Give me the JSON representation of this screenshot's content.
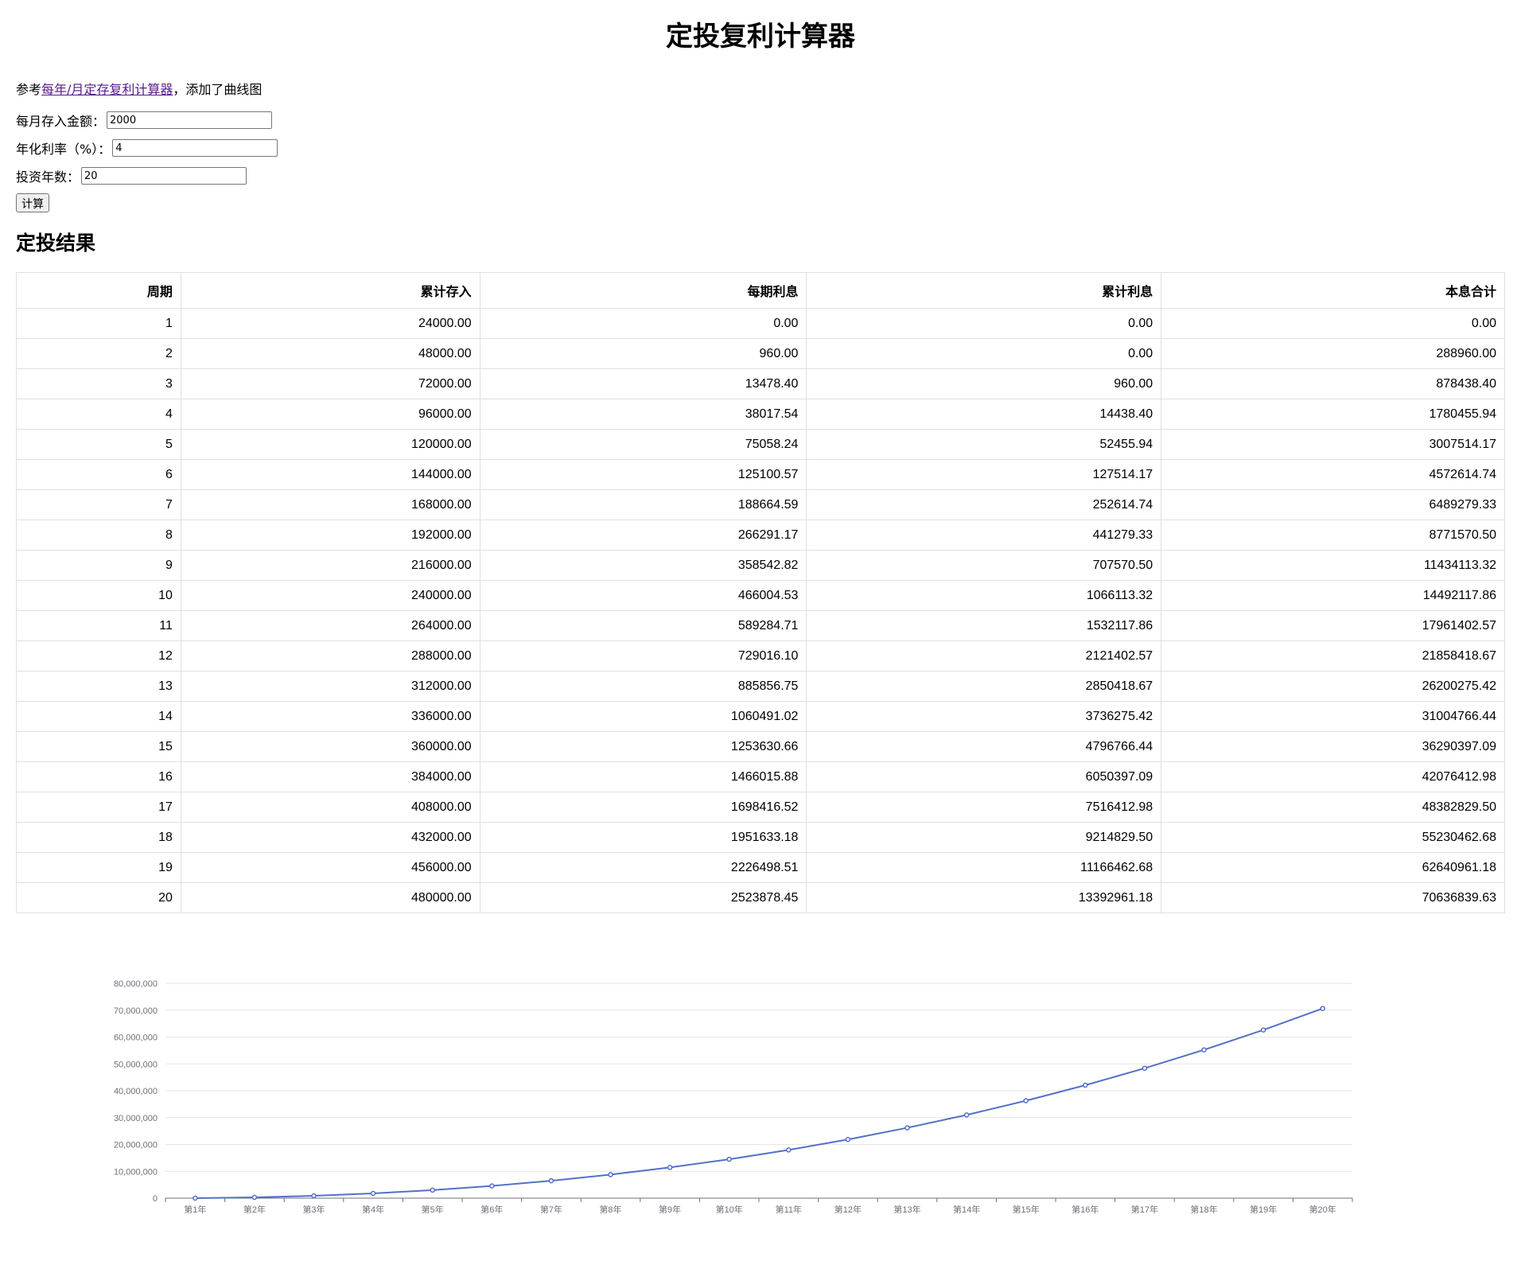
{
  "page": {
    "title": "定投复利计算器",
    "intro_prefix": "参考",
    "intro_link": "每年/月定存复利计算器",
    "intro_suffix": "，添加了曲线图"
  },
  "form": {
    "monthly_label": "每月存入金额：",
    "monthly_value": "2000",
    "rate_label": "年化利率（%）：",
    "rate_value": "4",
    "years_label": "投资年数：",
    "years_value": "20",
    "calc_button": "计算"
  },
  "results": {
    "heading": "定投结果",
    "columns": [
      "周期",
      "累计存入",
      "每期利息",
      "累计利息",
      "本息合计"
    ],
    "rows": [
      [
        "1",
        "24000.00",
        "0.00",
        "0.00",
        "0.00"
      ],
      [
        "2",
        "48000.00",
        "960.00",
        "0.00",
        "288960.00"
      ],
      [
        "3",
        "72000.00",
        "13478.40",
        "960.00",
        "878438.40"
      ],
      [
        "4",
        "96000.00",
        "38017.54",
        "14438.40",
        "1780455.94"
      ],
      [
        "5",
        "120000.00",
        "75058.24",
        "52455.94",
        "3007514.17"
      ],
      [
        "6",
        "144000.00",
        "125100.57",
        "127514.17",
        "4572614.74"
      ],
      [
        "7",
        "168000.00",
        "188664.59",
        "252614.74",
        "6489279.33"
      ],
      [
        "8",
        "192000.00",
        "266291.17",
        "441279.33",
        "8771570.50"
      ],
      [
        "9",
        "216000.00",
        "358542.82",
        "707570.50",
        "11434113.32"
      ],
      [
        "10",
        "240000.00",
        "466004.53",
        "1066113.32",
        "14492117.86"
      ],
      [
        "11",
        "264000.00",
        "589284.71",
        "1532117.86",
        "17961402.57"
      ],
      [
        "12",
        "288000.00",
        "729016.10",
        "2121402.57",
        "21858418.67"
      ],
      [
        "13",
        "312000.00",
        "885856.75",
        "2850418.67",
        "26200275.42"
      ],
      [
        "14",
        "336000.00",
        "1060491.02",
        "3736275.42",
        "31004766.44"
      ],
      [
        "15",
        "360000.00",
        "1253630.66",
        "4796766.44",
        "36290397.09"
      ],
      [
        "16",
        "384000.00",
        "1466015.88",
        "6050397.09",
        "42076412.98"
      ],
      [
        "17",
        "408000.00",
        "1698416.52",
        "7516412.98",
        "48382829.50"
      ],
      [
        "18",
        "432000.00",
        "1951633.18",
        "9214829.50",
        "55230462.68"
      ],
      [
        "19",
        "456000.00",
        "2226498.51",
        "11166462.68",
        "62640961.18"
      ],
      [
        "20",
        "480000.00",
        "2523878.45",
        "13392961.18",
        "70636839.63"
      ]
    ]
  },
  "chart_data": {
    "type": "line",
    "title": "",
    "xlabel": "",
    "ylabel": "",
    "categories": [
      "第1年",
      "第2年",
      "第3年",
      "第4年",
      "第5年",
      "第6年",
      "第7年",
      "第8年",
      "第9年",
      "第10年",
      "第11年",
      "第12年",
      "第13年",
      "第14年",
      "第15年",
      "第16年",
      "第17年",
      "第18年",
      "第19年",
      "第20年"
    ],
    "series": [
      {
        "values": [
          0,
          288960,
          878438.4,
          1780455.94,
          3007514.17,
          4572614.74,
          6489279.33,
          8771570.5,
          11434113.32,
          14492117.86,
          17961402.57,
          21858418.67,
          26200275.42,
          31004766.44,
          36290397.09,
          42076412.98,
          48382829.5,
          55230462.68,
          62640961.18,
          70636839.63
        ],
        "color": "#5470c6"
      }
    ],
    "ylim": [
      0,
      80000000
    ],
    "yticks": [
      "0",
      "10,000,000",
      "20,000,000",
      "30,000,000",
      "40,000,000",
      "50,000,000",
      "60,000,000",
      "70,000,000",
      "80,000,000"
    ],
    "grid": true,
    "legend": "none"
  }
}
